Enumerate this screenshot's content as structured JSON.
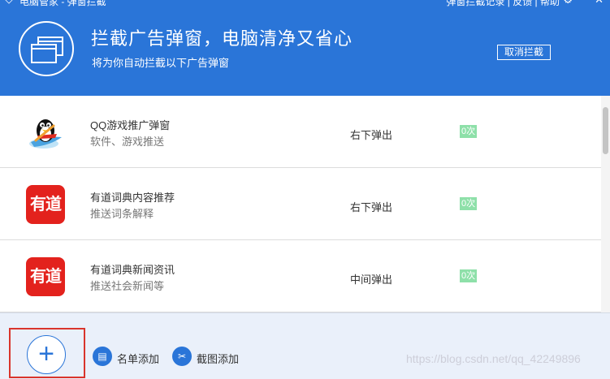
{
  "titlebar": {
    "app_title": "电脑管家 - 弹窗拦截",
    "links": "弹窗拦截记录 | 反馈 | 帮助",
    "back_glyph": "◇",
    "gear_glyph": "⚙",
    "close_glyph": "✕"
  },
  "hero": {
    "title": "拦截广告弹窗，电脑清净又省心",
    "subtitle": "将为你自动拦截以下广告弹窗",
    "cancel_label": "取消拦截",
    "icon": "windows-icon"
  },
  "items": [
    {
      "name": "QQ游戏推广弹窗",
      "desc": "软件、游戏推送",
      "position": "右下弹出",
      "count": "0次",
      "logo": "qq-penguin-icon"
    },
    {
      "name": "有道词典内容推荐",
      "desc": "推送词条解释",
      "position": "右下弹出",
      "count": "0次",
      "logo": "youdao-icon",
      "logo_text": "有道"
    },
    {
      "name": "有道词典新闻资讯",
      "desc": "推送社会新闻等",
      "position": "中间弹出",
      "count": "0次",
      "logo": "youdao-icon",
      "logo_text": "有道"
    }
  ],
  "footer": {
    "add_glyph": "+",
    "list_add_label": "名单添加",
    "screenshot_add_label": "截图添加",
    "list_icon_glyph": "▤",
    "shot_icon_glyph": "✂",
    "watermark": "https://blog.csdn.net/qq_42249896"
  },
  "colors": {
    "header_blue": "#2a75d8",
    "count_badge": "#8ee0a9",
    "highlight_red": "#d9352c",
    "youdao_red": "#e3221d"
  }
}
